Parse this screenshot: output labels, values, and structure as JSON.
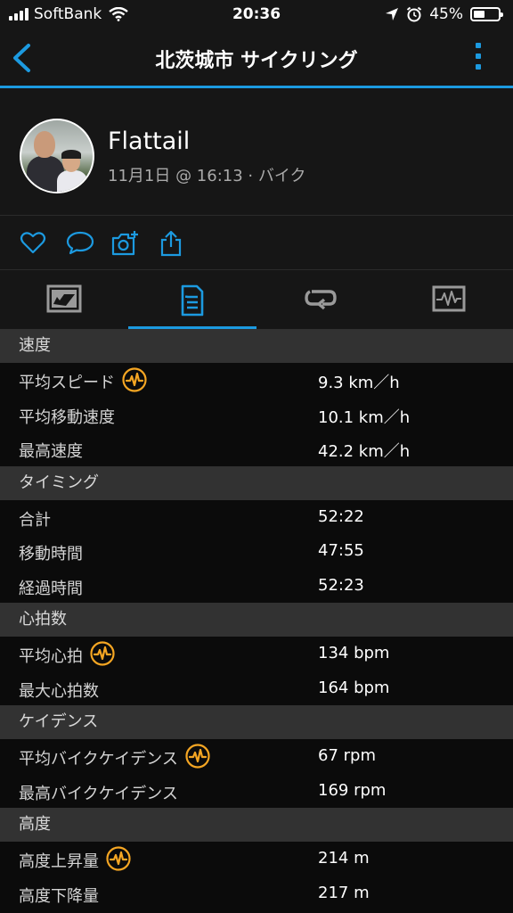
{
  "status_bar": {
    "carrier": "SoftBank",
    "time": "20:36",
    "battery": "45%",
    "battery_level": 0.45
  },
  "nav": {
    "title": "北茨城市 サイクリング"
  },
  "profile": {
    "name": "Flattail",
    "meta": "11月1日 @ 16:13 · バイク"
  },
  "sections": [
    {
      "title": "速度",
      "rows": [
        {
          "label": "平均スピード",
          "value": "9.3 km／h",
          "icon": true
        },
        {
          "label": "平均移動速度",
          "value": "10.1 km／h",
          "icon": false
        },
        {
          "label": "最高速度",
          "value": "42.2 km／h",
          "icon": false
        }
      ]
    },
    {
      "title": "タイミング",
      "rows": [
        {
          "label": "合計",
          "value": "52:22",
          "icon": false
        },
        {
          "label": "移動時間",
          "value": "47:55",
          "icon": false
        },
        {
          "label": "経過時間",
          "value": "52:23",
          "icon": false
        }
      ]
    },
    {
      "title": "心拍数",
      "rows": [
        {
          "label": "平均心拍",
          "value": "134 bpm",
          "icon": true
        },
        {
          "label": "最大心拍数",
          "value": "164 bpm",
          "icon": false
        }
      ]
    },
    {
      "title": "ケイデンス",
      "rows": [
        {
          "label": "平均バイクケイデンス",
          "value": "67 rpm",
          "icon": true
        },
        {
          "label": "最高バイクケイデンス",
          "value": "169 rpm",
          "icon": false
        }
      ]
    },
    {
      "title": "高度",
      "rows": [
        {
          "label": "高度上昇量",
          "value": "214 m",
          "icon": true
        },
        {
          "label": "高度下降量",
          "value": "217 m",
          "icon": false
        }
      ]
    }
  ],
  "colors": {
    "accent": "#1c9ae0",
    "chart_icon": "#f5a623",
    "section_bg": "#323232"
  }
}
